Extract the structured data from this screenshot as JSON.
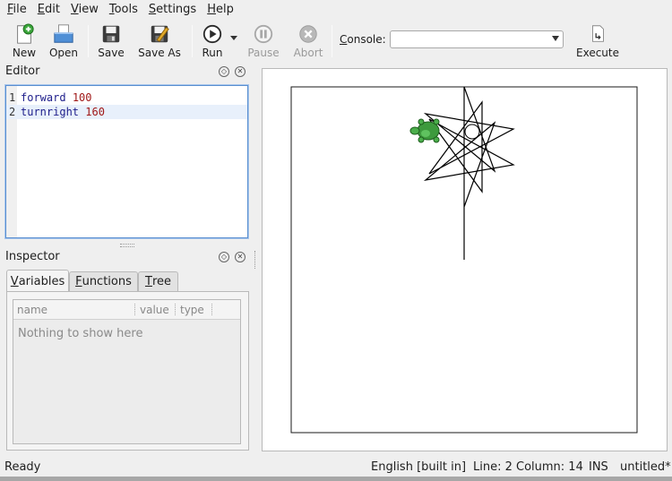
{
  "menu": [
    {
      "first": "F",
      "rest": "ile"
    },
    {
      "first": "E",
      "rest": "dit"
    },
    {
      "first": "V",
      "rest": "iew"
    },
    {
      "first": "T",
      "rest": "ools"
    },
    {
      "first": "S",
      "rest": "ettings"
    },
    {
      "first": "H",
      "rest": "elp"
    }
  ],
  "toolbar": {
    "new_label": "New",
    "open_label": "Open",
    "save_label": "Save",
    "save_as_label": "Save As",
    "run_label": "Run",
    "pause_label": "Pause",
    "abort_label": "Abort",
    "console_label_first": "C",
    "console_label_rest": "onsole:",
    "console_value": "",
    "execute_label": "Execute"
  },
  "editor": {
    "title": "Editor",
    "lines": [
      {
        "number": "1",
        "keyword": "forward",
        "value": "100"
      },
      {
        "number": "2",
        "keyword": "turnright",
        "value": "160"
      }
    ]
  },
  "inspector": {
    "title": "Inspector",
    "tabs": [
      {
        "first": "V",
        "rest": "ariables"
      },
      {
        "first": "F",
        "rest": "unctions"
      },
      {
        "first": "T",
        "rest": "ree"
      }
    ],
    "columns": [
      "name",
      "value",
      "type"
    ],
    "empty_message": "Nothing to show here"
  },
  "colors": {
    "accent": "#5a8fd0",
    "keyword": "#20208c",
    "number": "#a01818",
    "turtle": "#3d9a3d"
  },
  "status": {
    "state": "Ready",
    "language": "English [built in]",
    "position": "Line: 2 Column: 14",
    "mode": "INS",
    "file": "untitled*"
  }
}
